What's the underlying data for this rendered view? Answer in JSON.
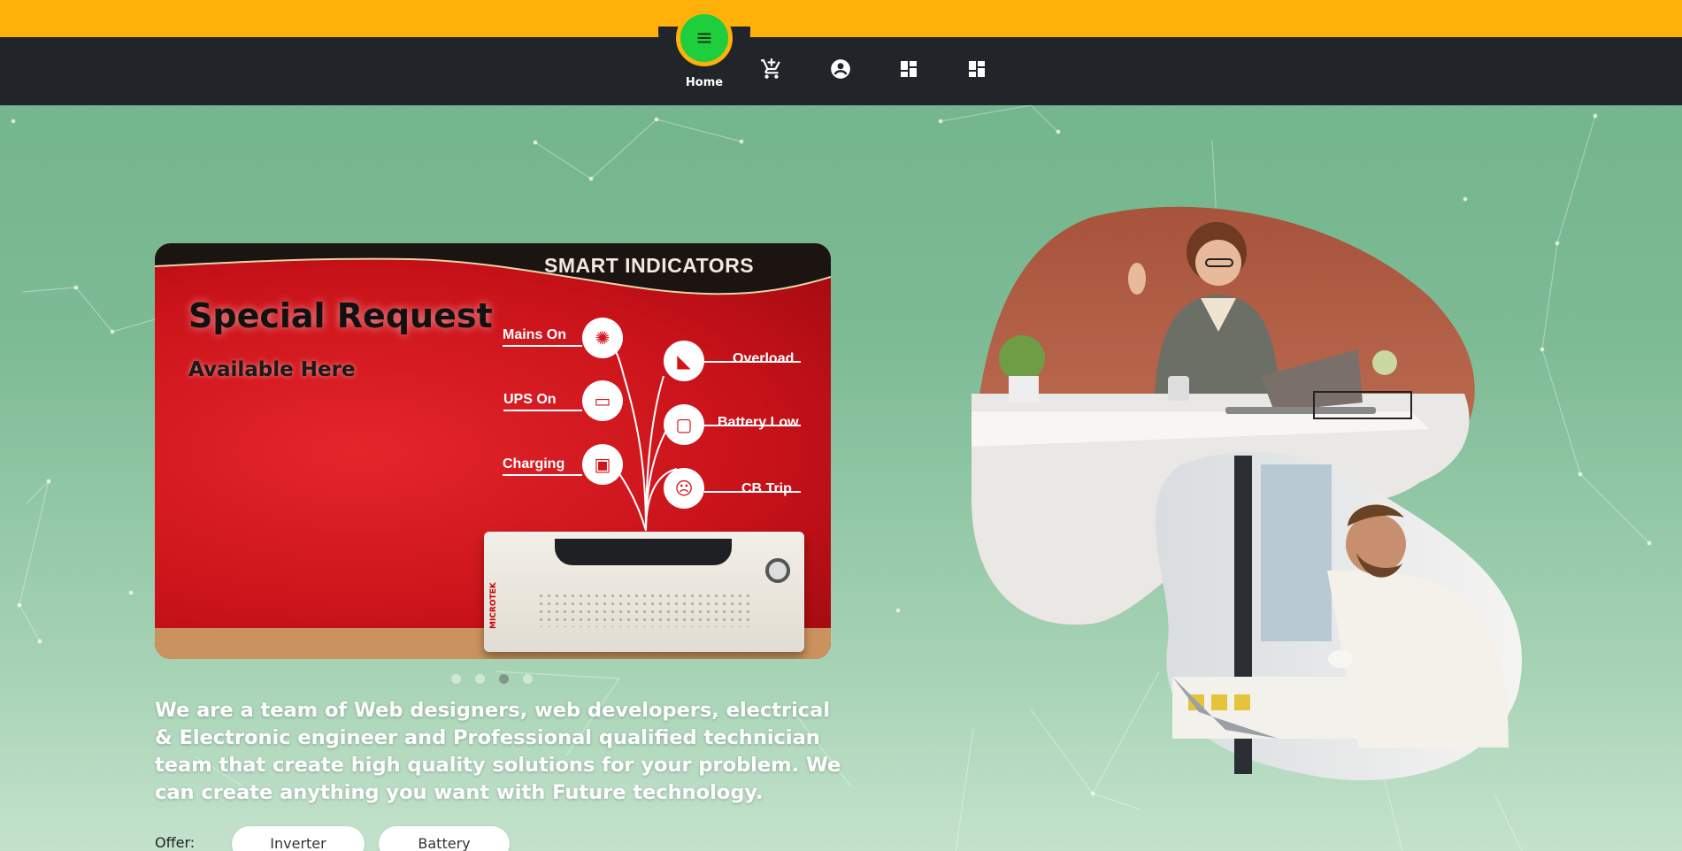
{
  "nav": {
    "home_label": "Home",
    "icons": [
      "menu-icon",
      "cart-icon",
      "account-icon",
      "dashboard-icon",
      "dashboard-icon"
    ]
  },
  "slider": {
    "banner_title": "SMART INDICATORS",
    "heading": "Special Request",
    "subheading": "Available Here",
    "left_indicators": [
      "Mains On",
      "UPS On",
      "Charging"
    ],
    "right_indicators": [
      "Overload",
      "Battery Low",
      "CB Trip"
    ],
    "product_brand": "MICROTEK",
    "slide_count": 4,
    "active_slide": 3
  },
  "about": {
    "text": "We are a team of Web designers, web developers, electrical & Electronic engineer and Professional qualified technician team that create high quality solutions for your problem. We can create anything you want with Future technology."
  },
  "offer": {
    "label": "Offer:",
    "items": [
      "Inverter",
      "Battery"
    ]
  },
  "colors": {
    "top_strip": "#ffb10a",
    "navbar": "#212428",
    "home_button": "#1fce3d",
    "background": "#6fb38a",
    "banner_red": "#c81219"
  }
}
